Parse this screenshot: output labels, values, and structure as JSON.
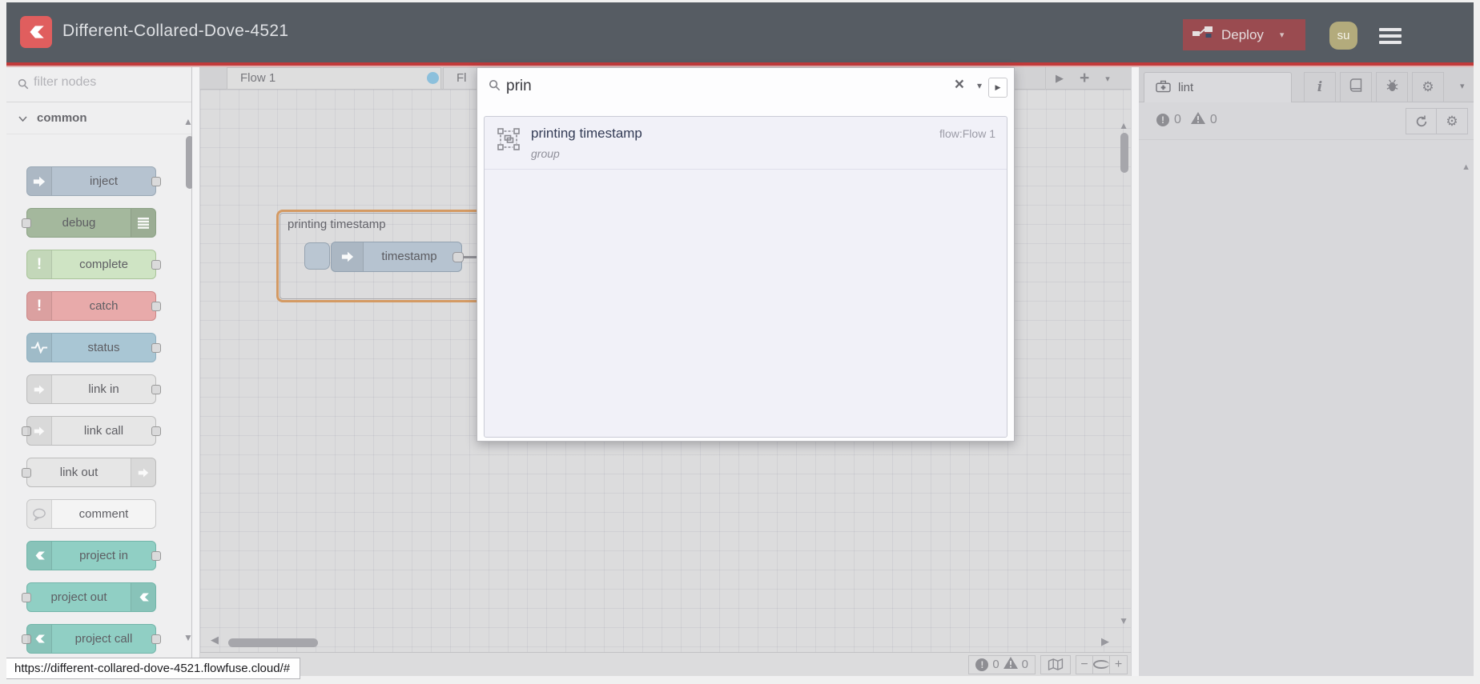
{
  "header": {
    "title": "Different-Collared-Dove-4521",
    "deploy_label": "Deploy",
    "avatar_text": "su"
  },
  "palette": {
    "filter_placeholder": "filter nodes",
    "category_label": "common",
    "nodes": [
      {
        "label": "inject",
        "color": "#b6c3d0",
        "border": "#9aa8b5",
        "icon": "inject-arrow-icon",
        "icon_side": "left",
        "ports": "right"
      },
      {
        "label": "debug",
        "color": "#a4b89d",
        "border": "#8ca285",
        "icon": "debug-list-icon",
        "icon_side": "right",
        "ports": "left"
      },
      {
        "label": "complete",
        "color": "#cfe4c4",
        "border": "#a9c49a",
        "icon": "exclamation-icon",
        "icon_side": "left",
        "ports": "right"
      },
      {
        "label": "catch",
        "color": "#e8aaaa",
        "border": "#cc8888",
        "icon": "exclamation-icon",
        "icon_side": "left",
        "ports": "right"
      },
      {
        "label": "status",
        "color": "#a9c6d4",
        "border": "#8fb0c0",
        "icon": "pulse-icon",
        "icon_side": "left",
        "ports": "right"
      },
      {
        "label": "link in",
        "color": "#e6e6e6",
        "border": "#bcbcbc",
        "icon": "link-arrow-icon",
        "icon_side": "left",
        "ports": "right"
      },
      {
        "label": "link call",
        "color": "#e6e6e6",
        "border": "#bcbcbc",
        "icon": "link-arrow-icon",
        "icon_side": "left",
        "ports": "both"
      },
      {
        "label": "link out",
        "color": "#e6e6e6",
        "border": "#bcbcbc",
        "icon": "link-arrow-icon",
        "icon_side": "right",
        "ports": "left"
      },
      {
        "label": "comment",
        "color": "#f4f4f4",
        "border": "#c8c8c8",
        "icon": "comment-bubble-icon",
        "icon_side": "left",
        "ports": "none"
      },
      {
        "label": "project in",
        "color": "#90cfc4",
        "border": "#72b5a9",
        "icon": "flowfuse-icon",
        "icon_side": "left",
        "ports": "right"
      },
      {
        "label": "project out",
        "color": "#90cfc4",
        "border": "#72b5a9",
        "icon": "flowfuse-icon",
        "icon_side": "right",
        "ports": "left"
      },
      {
        "label": "project call",
        "color": "#90cfc4",
        "border": "#72b5a9",
        "icon": "flowfuse-icon",
        "icon_side": "left",
        "ports": "both"
      }
    ]
  },
  "tabs": {
    "flow1_label": "Flow 1",
    "flow2_label": "Fl"
  },
  "canvas": {
    "group_label": "printing timestamp",
    "node_label": "timestamp"
  },
  "search": {
    "query": "prin",
    "results": [
      {
        "title": "printing timestamp",
        "location": "flow:Flow 1",
        "subtitle": "group"
      }
    ]
  },
  "sidebar": {
    "tab_label": "lint",
    "error_count": "0",
    "warning_count": "0"
  },
  "canvas_footer": {
    "error_count": "0",
    "warning_count": "0"
  },
  "status_bar": {
    "url": "https://different-collared-dove-4521.flowfuse.cloud/#"
  },
  "colors": {
    "header_bg": "#565c63",
    "accent_red": "#c13a3a",
    "deploy_bg": "#9a4b50",
    "group_border": "#d49a63",
    "unsaved_dot": "#8cc0dc",
    "result_list_bg": "#f1f1f8"
  }
}
